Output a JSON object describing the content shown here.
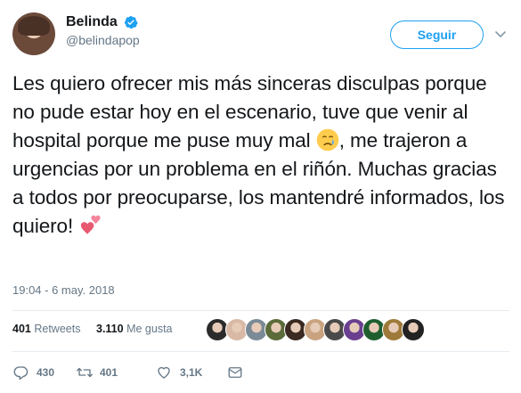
{
  "user": {
    "display_name": "Belinda",
    "handle": "@belindapop",
    "verified": true
  },
  "follow_button": {
    "label": "Seguir"
  },
  "tweet": {
    "text_part1": "Les quiero ofrecer mis más sinceras disculpas porque no pude estar hoy en el escenario, tuve que venir al hospital porque me puse muy mal ",
    "text_part2": ", me trajeron a urgencias por un problema en el riñón. Muchas gracias a todos por preocuparse, los mantendré informados, los quiero! ",
    "emojis": [
      "crying-face-emoji",
      "two-hearts-emoji"
    ],
    "timestamp": "19:04 - 6 may. 2018"
  },
  "stats": {
    "retweets_count": "401",
    "retweets_label": "Retweets",
    "likes_count": "3.110",
    "likes_label": "Me gusta"
  },
  "likers": [
    {
      "color": "#2b2b2b"
    },
    {
      "color": "#d8b9a5"
    },
    {
      "color": "#7a8a96"
    },
    {
      "color": "#5b6b3a"
    },
    {
      "color": "#3a2a22"
    },
    {
      "color": "#c9a37f"
    },
    {
      "color": "#4a4a4a"
    },
    {
      "color": "#6b3f8f"
    },
    {
      "color": "#1f5f2f"
    },
    {
      "color": "#9e7a3a"
    },
    {
      "color": "#222222"
    }
  ],
  "actions": {
    "reply_count": "430",
    "retweet_count": "401",
    "like_count": "3,1K"
  },
  "colors": {
    "accent": "#1da1f2",
    "text": "#14171a",
    "muted": "#657786",
    "divider": "#e6ecf0"
  }
}
